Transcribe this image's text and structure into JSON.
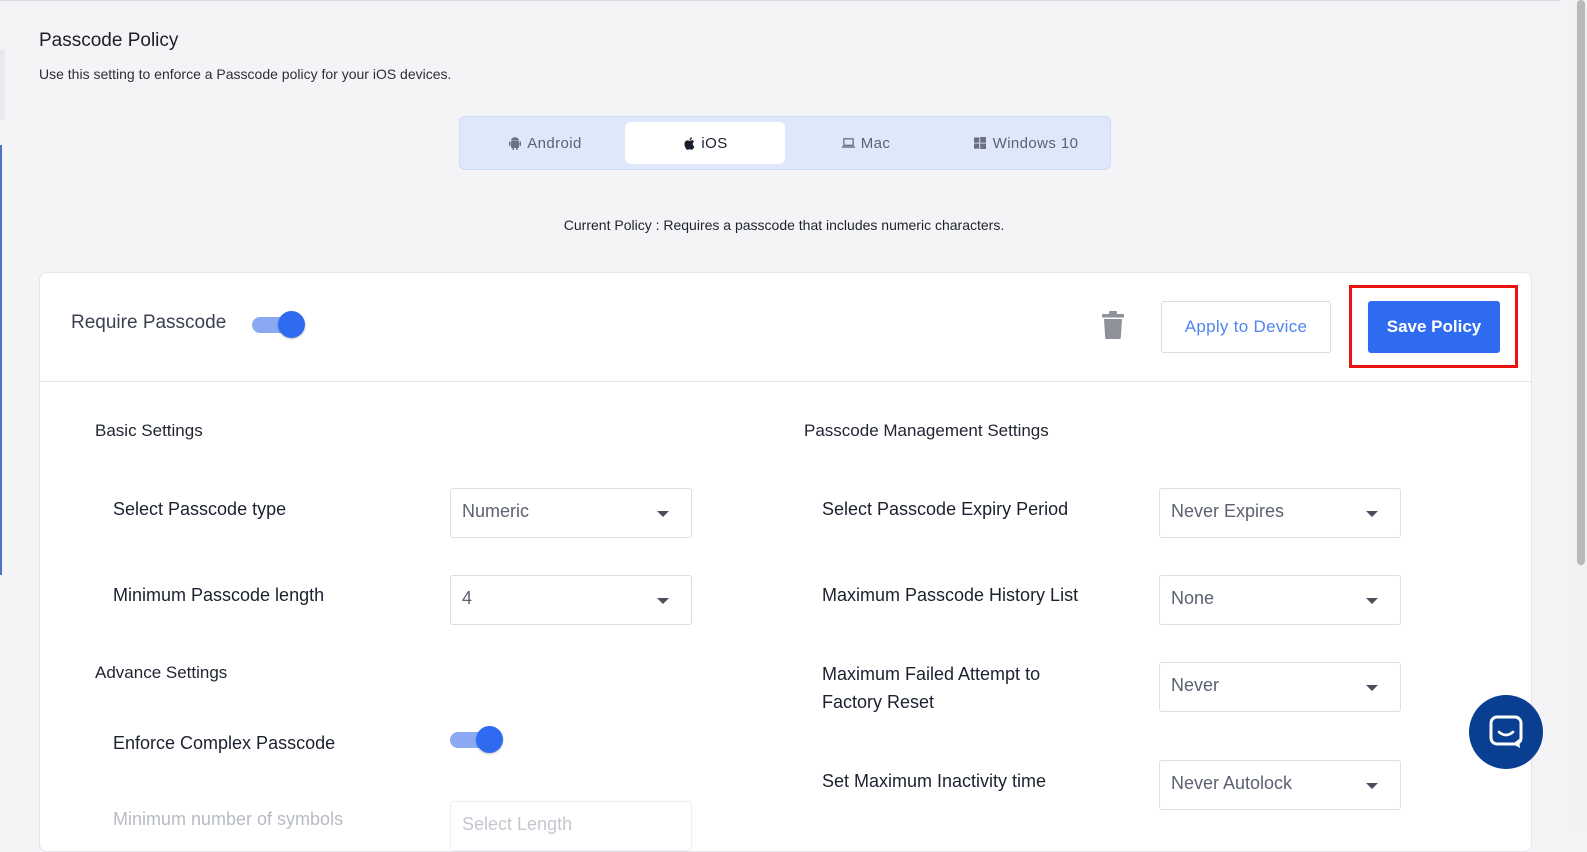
{
  "page": {
    "title": "Passcode Policy",
    "description": "Use this setting to enforce a Passcode policy for your iOS devices."
  },
  "os_tabs": [
    {
      "label": "Android",
      "icon": "android-icon",
      "active": false
    },
    {
      "label": "iOS",
      "icon": "apple-icon",
      "active": true
    },
    {
      "label": "Mac",
      "icon": "laptop-icon",
      "active": false
    },
    {
      "label": "Windows 10",
      "icon": "windows-icon",
      "active": false
    }
  ],
  "current_policy": "Current Policy : Requires a passcode that includes numeric characters.",
  "header": {
    "require_label": "Require Passcode",
    "require_enabled": true,
    "delete_icon": "trash-icon",
    "apply_label": "Apply to Device",
    "save_label": "Save Policy"
  },
  "basic": {
    "title": "Basic Settings",
    "passcode_type_label": "Select Passcode type",
    "passcode_type_value": "Numeric",
    "min_length_label": "Minimum Passcode length",
    "min_length_value": "4"
  },
  "advance": {
    "title": "Advance Settings",
    "complex_label": "Enforce Complex Passcode",
    "complex_enabled": true,
    "min_symbols_label": "Minimum number of symbols",
    "min_symbols_placeholder": "Select Length"
  },
  "management": {
    "title": "Passcode Management Settings",
    "expiry_label": "Select Passcode Expiry Period",
    "expiry_value": "Never Expires",
    "history_label": "Maximum Passcode History List",
    "history_value": "None",
    "failed_label_line1": "Maximum Failed Attempt to",
    "failed_label_line2": "Factory Reset",
    "failed_value": "Never",
    "inactivity_label": "Set Maximum Inactivity time",
    "inactivity_value": "Never Autolock"
  },
  "colors": {
    "primary": "#2f6bf0",
    "highlight": "#ee1313",
    "chat": "#0a3e91"
  }
}
